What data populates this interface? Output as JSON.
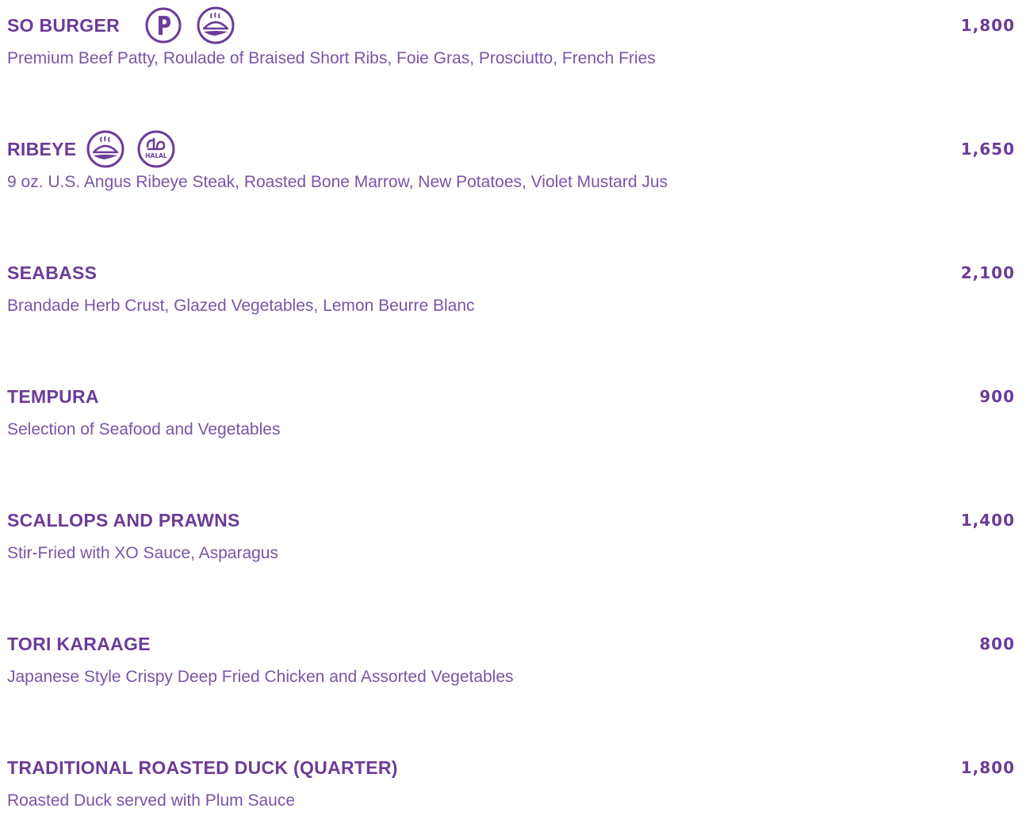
{
  "theme": {
    "accent": "#6b3c98",
    "text": "#7a55a6",
    "background": "#ffffff"
  },
  "items": [
    {
      "name": "SO BURGER",
      "price": "1,800",
      "description": "Premium Beef Patty, Roulade of Braised Short Ribs, Foie Gras, Prosciutto, French Fries",
      "icons": [
        "pork-icon",
        "signature-dish-icon"
      ]
    },
    {
      "name": "RIBEYE",
      "price": "1,650",
      "description": "9 oz. U.S. Angus Ribeye Steak, Roasted Bone Marrow, New Potatoes, Violet Mustard Jus",
      "icons": [
        "signature-dish-icon",
        "halal-icon"
      ],
      "halal_label": "HALAL"
    },
    {
      "name": "SEABASS",
      "price": "2,100",
      "description": "Brandade Herb Crust, Glazed Vegetables, Lemon Beurre Blanc"
    },
    {
      "name": "TEMPURA",
      "price": "900",
      "description": "Selection of Seafood and Vegetables"
    },
    {
      "name": "SCALLOPS AND PRAWNS",
      "price": "1,400",
      "description": "Stir-Fried with XO Sauce, Asparagus"
    },
    {
      "name": "TORI KARAAGE",
      "price": "800",
      "description": "Japanese Style Crispy Deep Fried Chicken and Assorted Vegetables"
    },
    {
      "name": "TRADITIONAL ROASTED DUCK (QUARTER)",
      "price": "1,800",
      "description": "Roasted Duck served with Plum Sauce"
    }
  ]
}
